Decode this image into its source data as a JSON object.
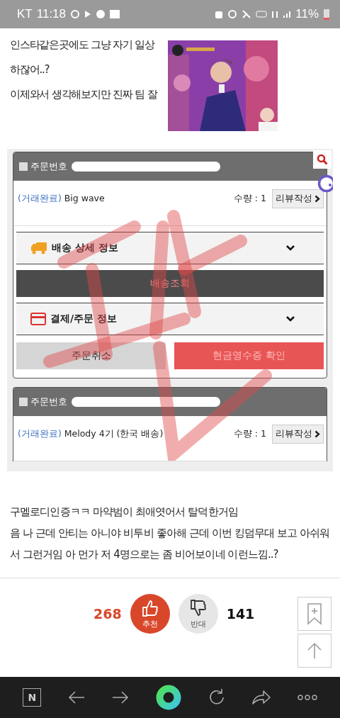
{
  "status_bar": {
    "carrier": "KT",
    "time": "11:18",
    "battery": "11%"
  },
  "post_lines": [
    "인스타같은곳에도 그냥 자기 일상",
    "하잖어..?",
    "이제와서 생각해보지만 진짜 팀 잘"
  ],
  "video": {
    "kind": "picture"
  },
  "orders": [
    {
      "order_label": "주문번호",
      "checked": false,
      "status": "(거래완료)",
      "product": "Big wave",
      "quantity": "수량 : 1",
      "review_button": "리뷰작성",
      "sections": [
        {
          "kind": "delivery",
          "title": "배송 상세 정보",
          "expanded": false
        },
        {
          "kind": "track",
          "title": "배송조회"
        },
        {
          "kind": "payment",
          "title": "결제/주문 정보",
          "expanded": false
        }
      ],
      "buttons": [
        {
          "label": "주문취소",
          "kind": "cancel"
        },
        {
          "label": "현금영수증 확인",
          "kind": "receipt"
        }
      ]
    },
    {
      "order_label": "주문번호",
      "checked": false,
      "status": "(거래완료)",
      "product": "Melody 4기 (한국 배송)",
      "quantity": "수량 : 1",
      "review_button": "리뷰작성"
    }
  ],
  "comment": [
    "구멜로디인증ㅋㅋ 마약범이 최애엿어서 탈덕한거임",
    "음 나 근데 안티는 아니야 비투비 좋아해 근데 이번 킹덤무대 보고 아쉬워서 그런거임 아 먼가 저 4명으로는 좀 비어보이네 이런느낌..?"
  ],
  "votes": {
    "up_count": "268",
    "up_label": "추천",
    "down_label": "반대",
    "down_count": "141"
  },
  "nav": {
    "logo": "N"
  }
}
